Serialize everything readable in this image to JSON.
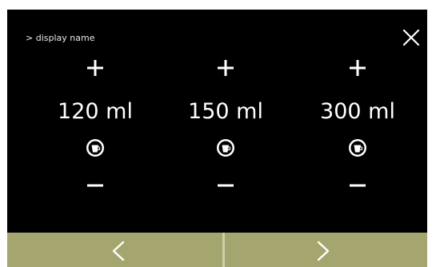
{
  "header": {
    "breadcrumb": "> display name",
    "close_icon": "close-icon"
  },
  "columns": [
    {
      "volume": "120 ml",
      "increase_icon": "plus-icon",
      "decrease_icon": "minus-icon",
      "cup_icon": "cup-icon"
    },
    {
      "volume": "150 ml",
      "increase_icon": "plus-icon",
      "decrease_icon": "minus-icon",
      "cup_icon": "cup-icon"
    },
    {
      "volume": "300 ml",
      "increase_icon": "plus-icon",
      "decrease_icon": "minus-icon",
      "cup_icon": "cup-icon"
    }
  ],
  "navigation": {
    "prev_icon": "chevron-left-icon",
    "next_icon": "chevron-right-icon"
  },
  "colors": {
    "background": "#000000",
    "text": "#ffffff",
    "nav_bar": "#a5a66f",
    "nav_divider": "#cfd0a8"
  }
}
